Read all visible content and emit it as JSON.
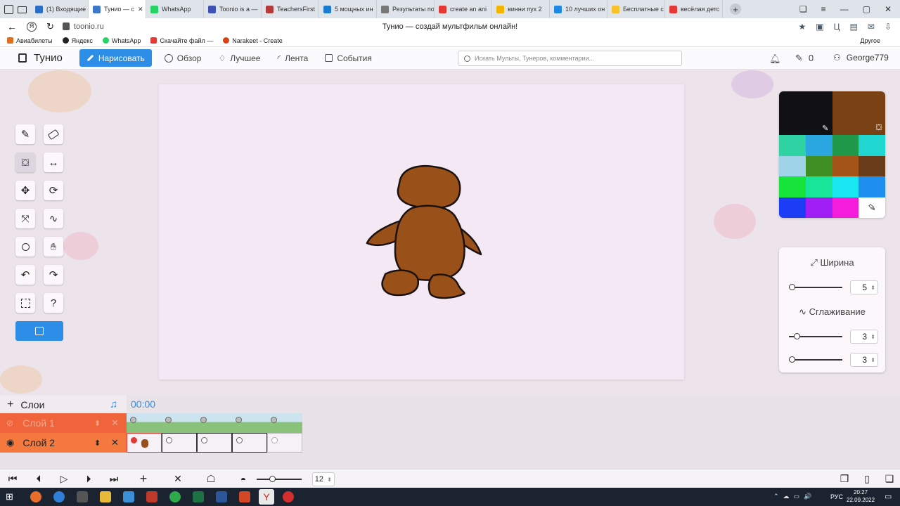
{
  "browser": {
    "tabs": [
      {
        "label": "(1) Входящие",
        "color": "#2a6ec9"
      },
      {
        "label": "Тунио — с",
        "color": "#3d78c9"
      },
      {
        "label": "WhatsApp",
        "color": "#25d366"
      },
      {
        "label": "Toonio is a —",
        "color": "#3f51b5"
      },
      {
        "label": "TeachersFirst",
        "color": "#b33b3b"
      },
      {
        "label": "5 мощных ин",
        "color": "#1b7bd1"
      },
      {
        "label": "Результаты по",
        "color": "#777777"
      },
      {
        "label": "create an ani",
        "color": "#e53935"
      },
      {
        "label": "винни пух 2",
        "color": "#f4b400"
      },
      {
        "label": "10 лучших он",
        "color": "#1e88e5"
      },
      {
        "label": "Бесплатные с",
        "color": "#f9c02a"
      },
      {
        "label": "весёлая детс",
        "color": "#e53935"
      }
    ],
    "url": "toonio.ru",
    "page_title": "Тунио — создай мультфильм онлайн!",
    "bookmarks": [
      "Авиабилеты",
      "Яндекс",
      "WhatsApp",
      "Скачайте файл —",
      "Narakeet - Create"
    ],
    "other_label": "Другое"
  },
  "header": {
    "logo": "Тунио",
    "draw": "Нарисовать",
    "nav": [
      "Обзор",
      "Лучшее",
      "Лента",
      "События"
    ],
    "search_placeholder": "Искать Мульты, Тунеров, комментарии...",
    "pencil_count": "0",
    "user": "George779"
  },
  "palette": {
    "primary": "#111014",
    "secondary": "#7a4214",
    "swatches": [
      "#2fd3a3",
      "#2aa6e0",
      "#20994a",
      "#1fd6d0",
      "#9fd4e8",
      "#3f8f23",
      "#a45416",
      "#6a3d1a",
      "#17e43b",
      "#18e49a",
      "#18e6f0",
      "#1e8ff0",
      "#1d3cf5",
      "#a01df5",
      "#f51ddb"
    ]
  },
  "brush": {
    "width_label": "Ширина",
    "width_value": "5",
    "width_level": 0.05,
    "smooth_label": "Сглаживание",
    "smooth_value": "3",
    "smooth_level": 0.14,
    "opacity_value": "3",
    "opacity_level": 0.05
  },
  "timeline": {
    "layers_label": "Слои",
    "time": "00:00",
    "layers": [
      {
        "name": "Слой 1",
        "color": "#f0643c"
      },
      {
        "name": "Слой 2",
        "color": "#f5793f"
      }
    ],
    "fps": "12",
    "fps_level": 0.35
  },
  "taskbar": {
    "lang": "РУС",
    "time": "20:27",
    "date": "22.09.2022"
  }
}
